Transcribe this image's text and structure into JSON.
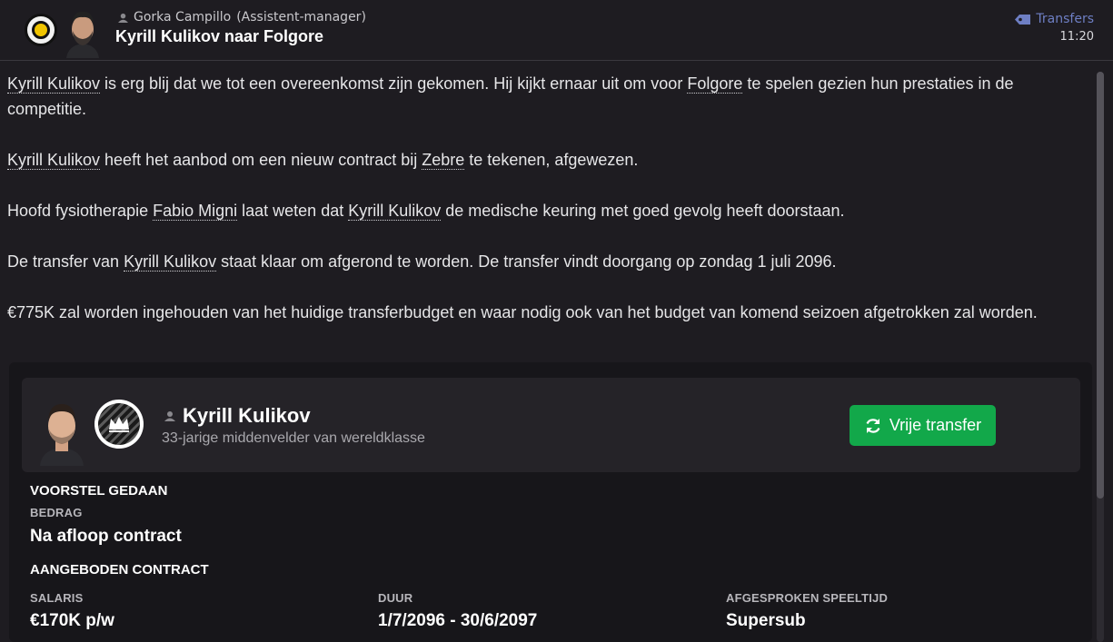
{
  "header": {
    "sender_name": "Gorka Campillo",
    "sender_role": "(Assistent-manager)",
    "subject": "Kyrill Kulikov naar Folgore",
    "category": "Transfers",
    "time": "11:20"
  },
  "body": {
    "p1": {
      "link1": "Kyrill Kulikov",
      "t1": " is erg blij dat we tot een overeenkomst zijn gekomen. Hij kijkt ernaar uit om voor ",
      "link2": "Folgore",
      "t2": " te spelen gezien hun prestaties in de competitie."
    },
    "p2": {
      "link1": "Kyrill Kulikov",
      "t1": " heeft het aanbod om een nieuw contract bij ",
      "link2": "Zebre",
      "t2": " te tekenen, afgewezen."
    },
    "p3": {
      "t0": "Hoofd fysiotherapie ",
      "link1": "Fabio Migni",
      "t1": " laat weten dat ",
      "link2": "Kyrill Kulikov",
      "t2": " de medische keuring met goed gevolg heeft doorstaan."
    },
    "p4": {
      "t0": "De transfer van ",
      "link1": "Kyrill Kulikov",
      "t1": " staat klaar om afgerond te worden. De transfer vindt doorgang op zondag 1 juli 2096."
    },
    "p5": {
      "t0": "€775K zal worden ingehouden van het huidige transferbudget en waar nodig ook van het budget van komend seizoen afgetrokken zal worden."
    }
  },
  "player": {
    "name": "Kyrill Kulikov",
    "description": "33-jarige middenvelder van wereldklasse",
    "transfer_button": "Vrije transfer"
  },
  "offer": {
    "heading": "VOORSTEL GEDAAN",
    "amount_label": "BEDRAG",
    "amount_value": "Na afloop contract",
    "contract_heading": "AANGEBODEN CONTRACT",
    "salary_label": "SALARIS",
    "salary_value": "€170K p/w",
    "duration_label": "DUUR",
    "duration_value": "1/7/2096 - 30/6/2097",
    "playtime_label": "AFGESPROKEN SPEELTIJD",
    "playtime_value": "Supersub"
  },
  "colors": {
    "background": "#1e1c21",
    "accent_category": "#6e7fc4",
    "button_green": "#12a84a"
  },
  "icons": {
    "category": "tag-icon",
    "button": "refresh-icon",
    "sender": "person-icon"
  }
}
